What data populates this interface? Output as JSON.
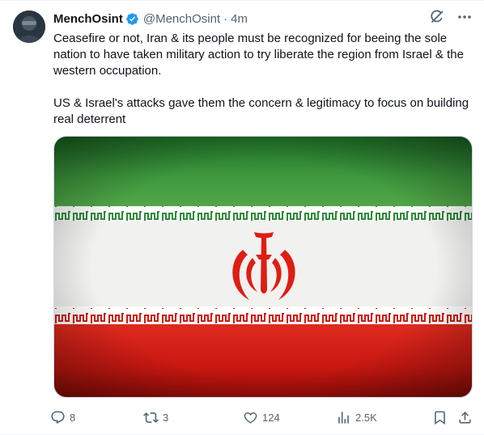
{
  "post": {
    "display_name": "MenchOsint",
    "handle": "@MenchOsint",
    "separator": "·",
    "time": "4m",
    "text": "Ceasefire or not, Iran & its people must be recognized for beeing the sole nation to have taken military action to try liberate the region from Israel & the western occupation.\n\nUS & Israel's attacks gave them the concern & legitimacy to focus on building real deterrent"
  },
  "metrics": {
    "replies": "8",
    "reposts": "3",
    "likes": "124",
    "views": "2.5K"
  },
  "icons": {
    "verified": "verified-badge-icon",
    "grok": "grok-icon",
    "more": "more-icon",
    "reply": "reply-icon",
    "repost": "repost-icon",
    "like": "like-icon",
    "views": "views-icon",
    "bookmark": "bookmark-icon",
    "share": "share-icon"
  },
  "colors": {
    "accent": "#1d9bf0",
    "text_primary": "#0f1419",
    "text_secondary": "#536471",
    "flag_green": "#239f40",
    "flag_white": "#ffffff",
    "flag_red": "#da0000"
  }
}
